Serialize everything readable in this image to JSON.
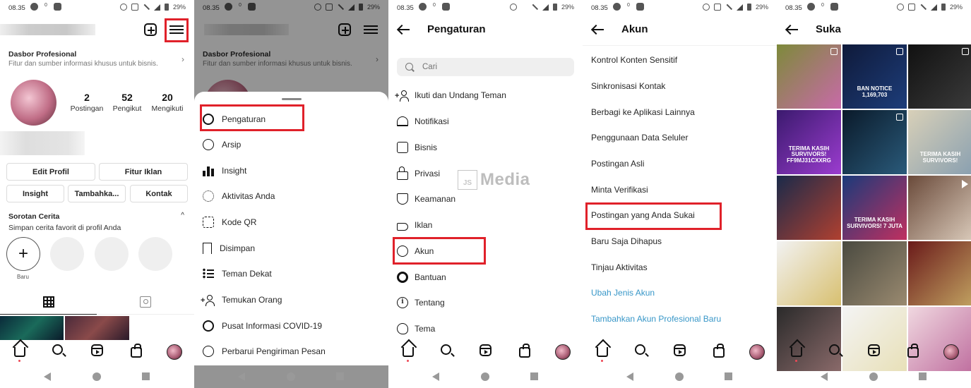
{
  "status_bar": {
    "time": "08.35",
    "network_speed": "0 KB/s",
    "network_type": "4G",
    "battery": "29%"
  },
  "watermark": {
    "logo": "JS",
    "text": "Media"
  },
  "profile": {
    "dashboard": {
      "title": "Dasbor Profesional",
      "subtitle": "Fitur dan sumber informasi khusus untuk bisnis."
    },
    "stats": [
      {
        "value": "2",
        "label": "Postingan"
      },
      {
        "value": "52",
        "label": "Pengikut"
      },
      {
        "value": "20",
        "label": "Mengikuti"
      }
    ],
    "buttons": {
      "edit_profile": "Edit Profil",
      "ad_tools": "Fitur Iklan",
      "insight": "Insight",
      "add": "Tambahka...",
      "contact": "Kontak"
    },
    "highlights": {
      "title": "Sorotan Cerita",
      "subtitle": "Simpan cerita favorit di profil Anda",
      "new_label": "Baru",
      "plus": "+"
    },
    "caret": "^"
  },
  "menu_sheet": {
    "items": [
      {
        "label": "Pengaturan",
        "icon": "gear-icon"
      },
      {
        "label": "Arsip",
        "icon": "archive-icon"
      },
      {
        "label": "Insight",
        "icon": "insights-icon"
      },
      {
        "label": "Aktivitas Anda",
        "icon": "activity-icon"
      },
      {
        "label": "Kode QR",
        "icon": "qr-code-icon"
      },
      {
        "label": "Disimpan",
        "icon": "bookmark-icon"
      },
      {
        "label": "Teman Dekat",
        "icon": "close-friends-icon"
      },
      {
        "label": "Temukan Orang",
        "icon": "add-person-icon"
      },
      {
        "label": "Pusat Informasi COVID-19",
        "icon": "covid-info-icon"
      },
      {
        "label": "Perbarui Pengiriman Pesan",
        "icon": "messenger-icon"
      }
    ]
  },
  "settings": {
    "title": "Pengaturan",
    "search_placeholder": "Cari",
    "items": [
      {
        "label": "Ikuti dan Undang Teman",
        "icon": "add-person-icon"
      },
      {
        "label": "Notifikasi",
        "icon": "bell-icon"
      },
      {
        "label": "Bisnis",
        "icon": "shop-icon"
      },
      {
        "label": "Privasi",
        "icon": "lock-icon"
      },
      {
        "label": "Keamanan",
        "icon": "shield-icon"
      },
      {
        "label": "Iklan",
        "icon": "megaphone-icon"
      },
      {
        "label": "Akun",
        "icon": "account-icon"
      },
      {
        "label": "Bantuan",
        "icon": "help-lifebuoy-icon"
      },
      {
        "label": "Tentang",
        "icon": "info-icon"
      },
      {
        "label": "Tema",
        "icon": "palette-icon"
      }
    ]
  },
  "account": {
    "title": "Akun",
    "items": [
      {
        "label": "Kontrol Konten Sensitif"
      },
      {
        "label": "Sinkronisasi Kontak"
      },
      {
        "label": "Berbagi ke Aplikasi Lainnya"
      },
      {
        "label": "Penggunaan Data Seluler"
      },
      {
        "label": "Postingan Asli"
      },
      {
        "label": "Minta Verifikasi"
      },
      {
        "label": "Postingan yang Anda Sukai"
      },
      {
        "label": "Baru Saja Dihapus"
      },
      {
        "label": "Tinjau Aktivitas"
      }
    ],
    "links": [
      {
        "label": "Ubah Jenis Akun"
      },
      {
        "label": "Tambahkan Akun Profesional Baru"
      }
    ],
    "link_color": "#3897c8"
  },
  "likes": {
    "title": "Suka",
    "posts": [
      {
        "caption": "",
        "type": "reel",
        "colors": [
          "#7d8a3a",
          "#c86aa8"
        ]
      },
      {
        "caption": "BAN NOTICE 1,169,703",
        "type": "carousel",
        "colors": [
          "#0f1a3a",
          "#1d3d7a"
        ]
      },
      {
        "caption": "",
        "type": "carousel",
        "colors": [
          "#111",
          "#3a3a3a"
        ]
      },
      {
        "caption": "TERIMA KASIH SURVIVORS! FF9MJ31CXXRG",
        "type": "image",
        "colors": [
          "#3b1a6e",
          "#9b3ccf"
        ]
      },
      {
        "caption": "",
        "type": "carousel",
        "colors": [
          "#0a1a2a",
          "#2a5a7a"
        ]
      },
      {
        "caption": "TERIMA KASIH SURVIVORS!",
        "type": "image",
        "colors": [
          "#d8d0b8",
          "#8aa0b0"
        ]
      },
      {
        "caption": "",
        "type": "image",
        "colors": [
          "#1a2a4a",
          "#b04030"
        ]
      },
      {
        "caption": "TERIMA KASIH SURVIVORS! 7 JUTA",
        "type": "image",
        "colors": [
          "#1a3a7a",
          "#c03060"
        ]
      },
      {
        "caption": "",
        "type": "video",
        "colors": [
          "#6a4a3a",
          "#d8c8b8"
        ]
      },
      {
        "caption": "",
        "type": "image",
        "colors": [
          "#f2f2f2",
          "#d8c070"
        ]
      },
      {
        "caption": "",
        "type": "image",
        "colors": [
          "#4a4a40",
          "#9a8a70"
        ]
      },
      {
        "caption": "",
        "type": "image",
        "colors": [
          "#6a1a1a",
          "#c0a060"
        ]
      },
      {
        "caption": "",
        "type": "image",
        "colors": [
          "#2a2a2a",
          "#8a6a6a"
        ]
      },
      {
        "caption": "",
        "type": "image",
        "colors": [
          "#f4f4f4",
          "#e8e0b8"
        ]
      },
      {
        "caption": "",
        "type": "image",
        "colors": [
          "#f0d8e0",
          "#c070a0"
        ]
      }
    ]
  },
  "bottom_nav": [
    "home-icon",
    "search-icon",
    "reels-icon",
    "shop-icon",
    "profile-avatar"
  ],
  "highlight_color": "#e0212a"
}
